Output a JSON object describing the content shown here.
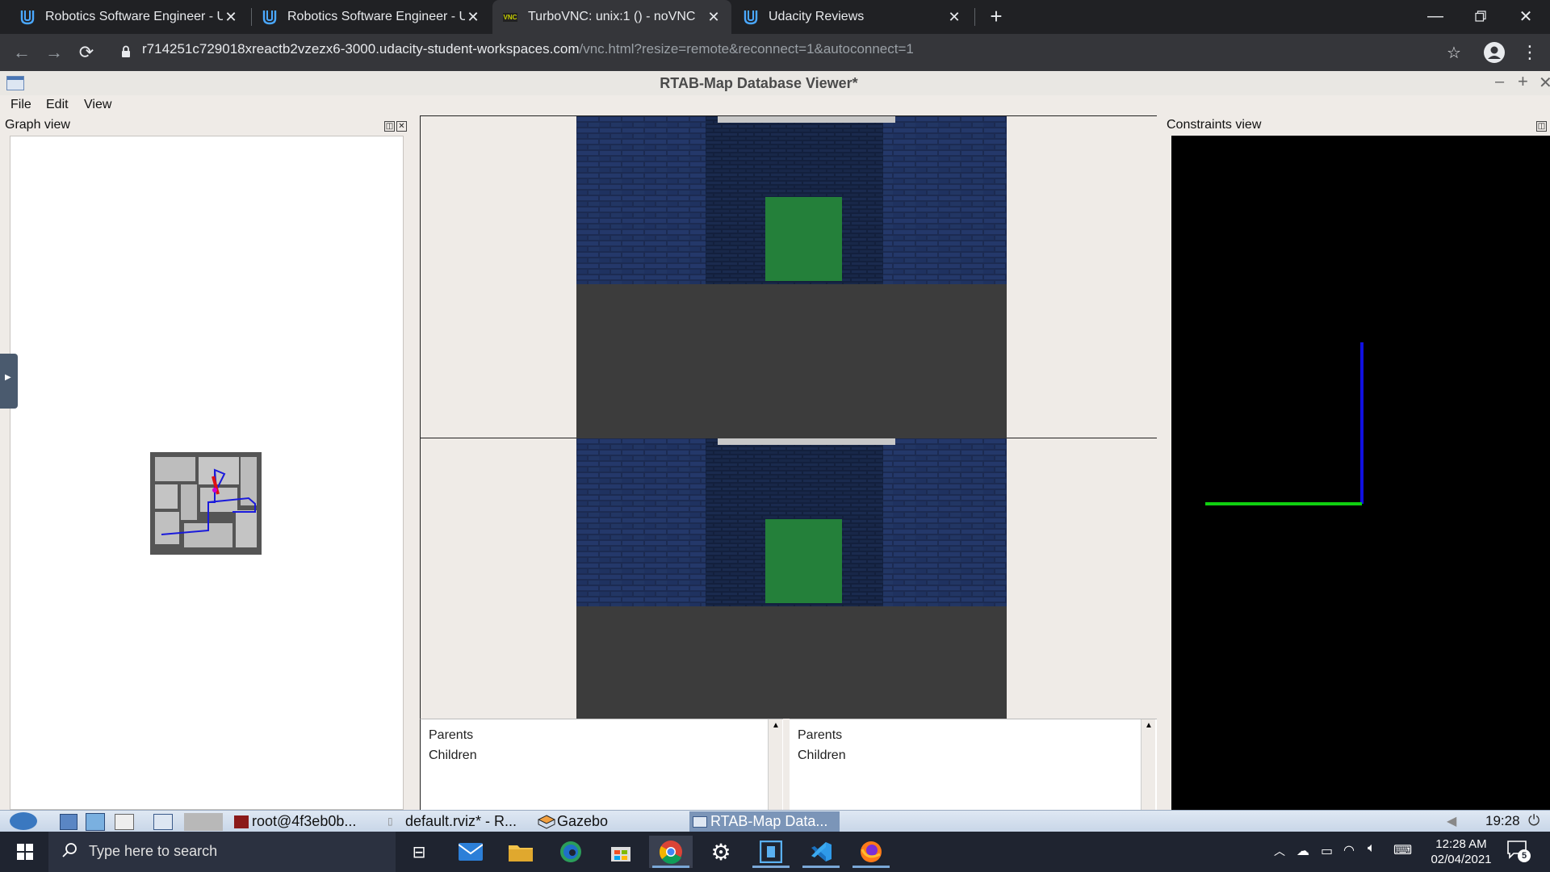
{
  "browser": {
    "tabs": [
      {
        "title": "Robotics Software Engineer - Ud",
        "active": false
      },
      {
        "title": "Robotics Software Engineer - Ud",
        "active": false
      },
      {
        "title": "TurboVNC: unix:1 () - noVNC",
        "active": true
      },
      {
        "title": "Udacity Reviews",
        "active": false
      }
    ],
    "favicon_vnc_text": "VNC",
    "new_tab_symbol": "+",
    "url_host": "r714251c729018xreactb2vzezx6-3000.udacity-student-workspaces.com",
    "url_path": "/vnc.html?resize=remote&reconnect=1&autoconnect=1"
  },
  "app": {
    "title": "RTAB-Map Database Viewer*",
    "menu": [
      "File",
      "Edit",
      "View"
    ],
    "graph_view_title": "Graph view",
    "constraints_view_title": "Constraints view",
    "left_info": {
      "parents": "Parents",
      "children": "Children"
    },
    "right_info": {
      "parents": "Parents",
      "children": "Children"
    }
  },
  "remote_panel": {
    "tasks": [
      {
        "label": "root@4f3eb0b..."
      },
      {
        "label": "default.rviz* - R..."
      },
      {
        "label": "Gazebo"
      },
      {
        "label": "RTAB-Map Data..."
      }
    ],
    "clock": "19:28"
  },
  "windows_taskbar": {
    "search_placeholder": "Type here to search",
    "time": "12:28 AM",
    "date": "02/04/2021",
    "notifications": "5"
  },
  "colors": {
    "accent_green": "#24803a",
    "axis_blue": "#1010e0",
    "axis_green": "#10d010",
    "brick_blue": "#1a2d5a"
  }
}
